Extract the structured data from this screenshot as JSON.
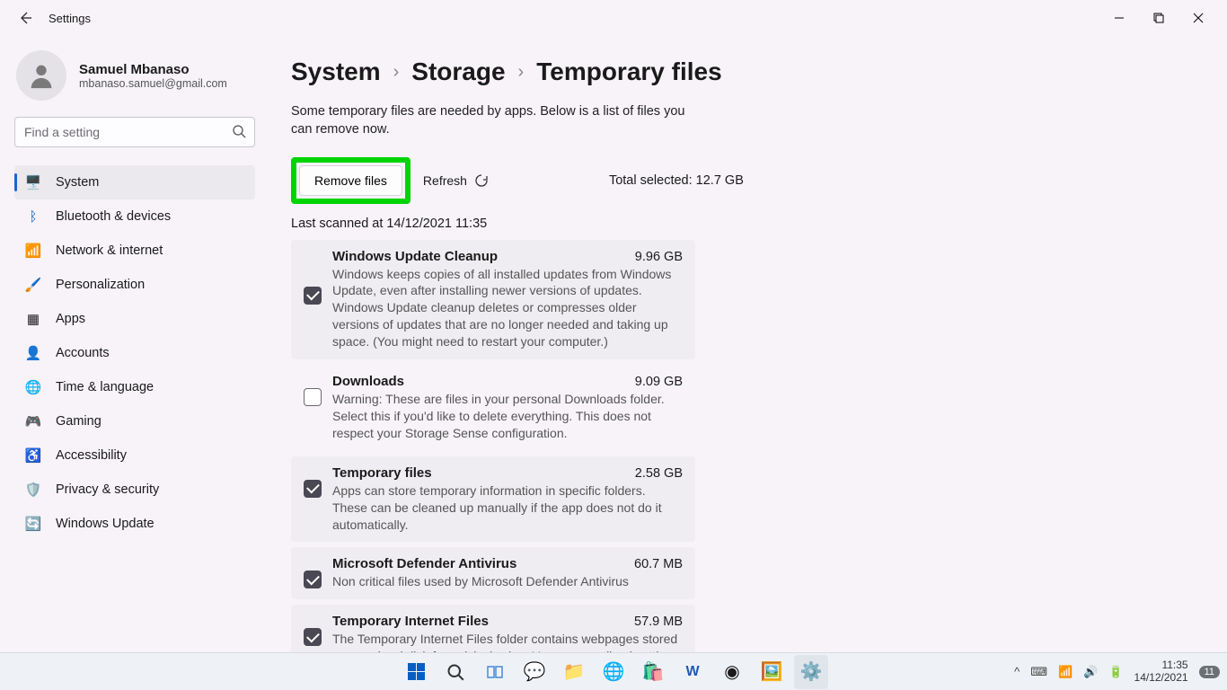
{
  "window": {
    "title": "Settings"
  },
  "user": {
    "name": "Samuel Mbanaso",
    "email": "mbanaso.samuel@gmail.com"
  },
  "search": {
    "placeholder": "Find a setting"
  },
  "nav": [
    {
      "icon": "🖥️",
      "label": "System",
      "active": true
    },
    {
      "icon": "bt",
      "label": "Bluetooth & devices"
    },
    {
      "icon": "📶",
      "label": "Network & internet"
    },
    {
      "icon": "🖌️",
      "label": "Personalization"
    },
    {
      "icon": "▦",
      "label": "Apps"
    },
    {
      "icon": "👤",
      "label": "Accounts"
    },
    {
      "icon": "🌐",
      "label": "Time & language"
    },
    {
      "icon": "🎮",
      "label": "Gaming"
    },
    {
      "icon": "♿",
      "label": "Accessibility"
    },
    {
      "icon": "🛡️",
      "label": "Privacy & security"
    },
    {
      "icon": "🔄",
      "label": "Windows Update"
    }
  ],
  "breadcrumb": {
    "a": "System",
    "b": "Storage",
    "c": "Temporary files"
  },
  "desc": "Some temporary files are needed by apps. Below is a list of files you can remove now.",
  "actions": {
    "remove": "Remove files",
    "refresh": "Refresh",
    "total": "Total selected: 12.7 GB"
  },
  "lastscan": "Last scanned at 14/12/2021 11:35",
  "items": [
    {
      "title": "Windows Update Cleanup",
      "size": "9.96 GB",
      "desc": "Windows keeps copies of all installed updates from Windows Update, even after installing newer versions of updates. Windows Update cleanup deletes or compresses older versions of updates that are no longer needed and taking up space. (You might need to restart your computer.)",
      "checked": true,
      "plain": false
    },
    {
      "title": "Downloads",
      "size": "9.09 GB",
      "desc": "Warning: These are files in your personal Downloads folder. Select this if you'd like to delete everything. This does not respect your Storage Sense configuration.",
      "checked": false,
      "plain": true
    },
    {
      "title": "Temporary files",
      "size": "2.58 GB",
      "desc": "Apps can store temporary information in specific folders. These can be cleaned up manually if the app does not do it automatically.",
      "checked": true,
      "plain": false
    },
    {
      "title": "Microsoft Defender Antivirus",
      "size": "60.7 MB",
      "desc": "Non critical files used by Microsoft Defender Antivirus",
      "checked": true,
      "plain": false
    },
    {
      "title": "Temporary Internet Files",
      "size": "57.9 MB",
      "desc": "The Temporary Internet Files folder contains webpages stored on your hard disk for quick viewing. Your personalized settings for webpages will be left intact.",
      "checked": true,
      "plain": false
    }
  ],
  "tray": {
    "time": "11:35",
    "date": "14/12/2021",
    "badge": "11"
  }
}
